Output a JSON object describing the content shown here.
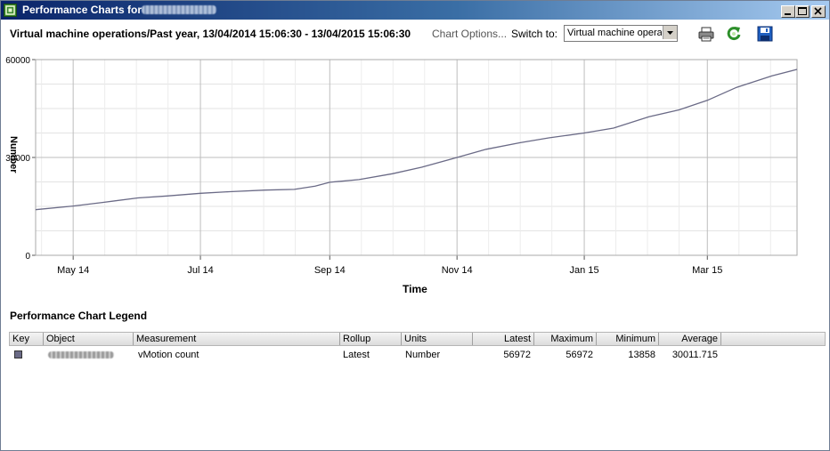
{
  "window": {
    "title": "Performance Charts for"
  },
  "header": {
    "chart_title": "Virtual machine operations/Past year, 13/04/2014 15:06:30 - 13/04/2015 15:06:30",
    "chart_options": "Chart Options...",
    "switch_label": "Switch to:",
    "switch_value": "Virtual machine operations"
  },
  "toolbar": {
    "print_icon": "printer-icon",
    "refresh_icon": "refresh-icon",
    "save_icon": "save-floppy-icon"
  },
  "chart_data": {
    "type": "line",
    "title": "",
    "xlabel": "Time",
    "ylabel": "Number",
    "ylim": [
      0,
      60000
    ],
    "yticks": [
      0,
      30000,
      60000
    ],
    "xlim": [
      "2014-04-13",
      "2015-04-13"
    ],
    "xticks": [
      {
        "label": "May 14",
        "date": "2014-05-01"
      },
      {
        "label": "Jul 14",
        "date": "2014-07-01"
      },
      {
        "label": "Sep 14",
        "date": "2014-09-01"
      },
      {
        "label": "Nov 14",
        "date": "2014-11-01"
      },
      {
        "label": "Jan 15",
        "date": "2015-01-01"
      },
      {
        "label": "Mar 15",
        "date": "2015-03-01"
      }
    ],
    "grid": true,
    "series": [
      {
        "name": "vMotion count",
        "color": "#6a6a86",
        "points": [
          [
            "2014-04-13",
            14000
          ],
          [
            "2014-05-01",
            15100
          ],
          [
            "2014-05-15",
            16200
          ],
          [
            "2014-06-01",
            17600
          ],
          [
            "2014-06-15",
            18200
          ],
          [
            "2014-07-01",
            19000
          ],
          [
            "2014-07-15",
            19500
          ],
          [
            "2014-08-01",
            20000
          ],
          [
            "2014-08-15",
            20200
          ],
          [
            "2014-08-25",
            21200
          ],
          [
            "2014-09-01",
            22400
          ],
          [
            "2014-09-15",
            23200
          ],
          [
            "2014-10-01",
            25000
          ],
          [
            "2014-10-15",
            27000
          ],
          [
            "2014-11-01",
            30000
          ],
          [
            "2014-11-15",
            32500
          ],
          [
            "2014-12-01",
            34500
          ],
          [
            "2014-12-15",
            36000
          ],
          [
            "2015-01-01",
            37500
          ],
          [
            "2015-01-15",
            39000
          ],
          [
            "2015-02-01",
            42500
          ],
          [
            "2015-02-15",
            44500
          ],
          [
            "2015-03-01",
            47500
          ],
          [
            "2015-03-15",
            51500
          ],
          [
            "2015-04-01",
            55000
          ],
          [
            "2015-04-13",
            57000
          ]
        ]
      }
    ]
  },
  "legend": {
    "title": "Performance Chart Legend",
    "columns": [
      "Key",
      "Object",
      "Measurement",
      "Rollup",
      "Units",
      "Latest",
      "Maximum",
      "Minimum",
      "Average"
    ],
    "rows": [
      {
        "key_color": "#6a6a86",
        "measurement": "vMotion count",
        "rollup": "Latest",
        "units": "Number",
        "latest": "56972",
        "maximum": "56972",
        "minimum": "13858",
        "average": "30011.715"
      }
    ]
  }
}
